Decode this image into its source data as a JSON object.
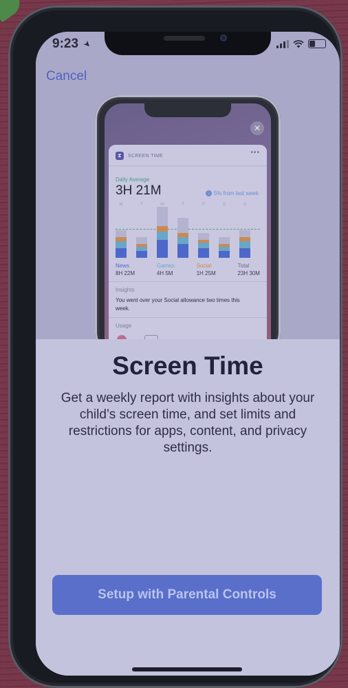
{
  "status_bar": {
    "time": "9:23"
  },
  "nav": {
    "cancel_label": "Cancel"
  },
  "preview": {
    "widget_title": "SCREEN TIME",
    "more_label": "•••",
    "close_label": "✕",
    "daily_label": "Daily Average",
    "daily_value": "3H 21M",
    "trend_label": "5% from last week",
    "days": [
      "M",
      "T",
      "W",
      "T",
      "F",
      "S",
      "S"
    ],
    "legend": [
      {
        "name": "News",
        "value": "8H 22M",
        "color": "#4d68c8"
      },
      {
        "name": "Games",
        "value": "4H 5M",
        "color": "#6aa6c7"
      },
      {
        "name": "Social",
        "value": "1H 25M",
        "color": "#c98a52"
      },
      {
        "name": "Total",
        "value": "23H 30M",
        "color": "#2e2d44"
      }
    ],
    "insights_title": "Insights",
    "insights_text": "You went over your Social allowance two times this week.",
    "usage_title": "Usage"
  },
  "sheet": {
    "title": "Screen Time",
    "description": "Get a weekly report with insights about your child’s screen time, and set limits and restrictions for apps, content, and privacy settings.",
    "button_label": "Setup with Parental Controls"
  },
  "colors": {
    "accent": "#5a6fc9",
    "link": "#4f62c0"
  }
}
